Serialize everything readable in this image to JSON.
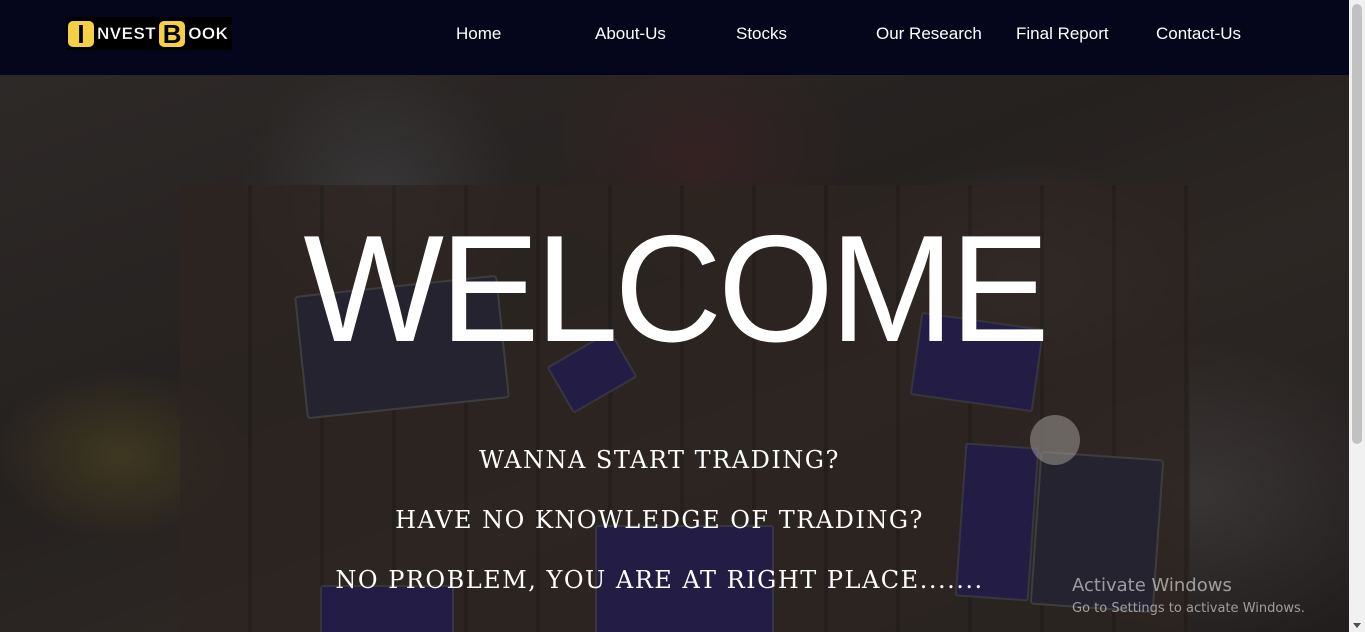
{
  "brand": {
    "logo_first_letter": "I",
    "logo_word1": "NVEST",
    "logo_second_letter": "B",
    "logo_word2": "OOK"
  },
  "nav": {
    "items": [
      {
        "label": "Home"
      },
      {
        "label": "About-Us"
      },
      {
        "label": "Stocks"
      },
      {
        "label": "Our Research"
      },
      {
        "label": "Final Report"
      },
      {
        "label": "Contact-Us"
      }
    ]
  },
  "hero": {
    "title": "WELCOME",
    "lines": [
      "WANNA START TRADING?",
      "HAVE NO KNOWLEDGE OF TRADING?",
      "NO PROBLEM, YOU ARE AT RIGHT PLACE......."
    ]
  },
  "watermark": {
    "title": "Activate Windows",
    "subtitle": "Go to Settings to activate Windows."
  },
  "colors": {
    "navbar_bg": "#05051c",
    "logo_accent": "#f5cf45",
    "text": "#ffffff"
  }
}
